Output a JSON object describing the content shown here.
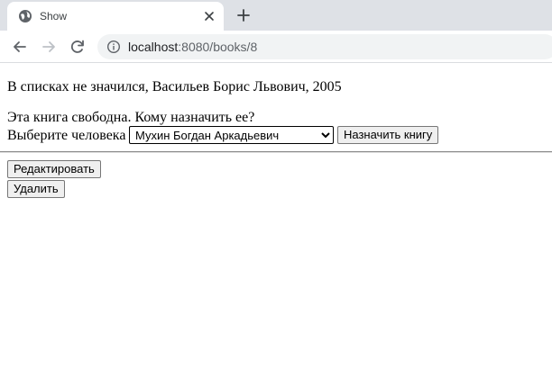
{
  "browser": {
    "tab": {
      "title": "Show",
      "favicon": "globe-icon",
      "close": "close-icon"
    },
    "new_tab": "plus-icon",
    "nav": {
      "back": "back-arrow-icon",
      "forward": "forward-arrow-icon",
      "reload": "reload-icon"
    },
    "address": {
      "host": "localhost",
      "path": ":8080/books/8",
      "site_info": "info-icon"
    }
  },
  "page": {
    "book_info": "В списках не значился, Васильев Борис Львович, 2005",
    "free_text": "Эта книга свободна. Кому назначить ее?",
    "choose_label": "Выберите человека",
    "person_select": {
      "selected": "Мухин Богдан Аркадьевич"
    },
    "assign_button": "Назначить книгу",
    "edit_button": "Редактировать",
    "delete_button": "Удалить"
  }
}
